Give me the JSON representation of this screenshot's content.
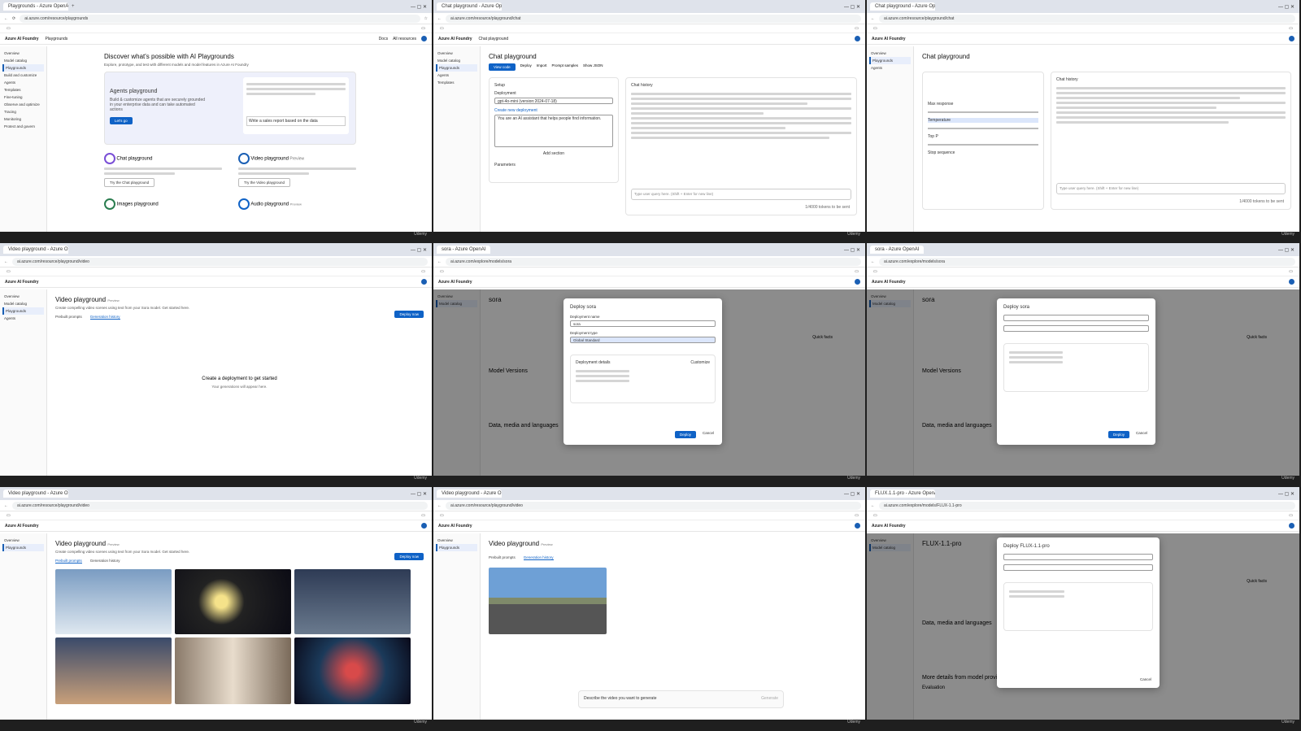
{
  "panels": [
    {
      "tabs": [
        "Playgrounds - Azure OpenAI"
      ],
      "url": "ai.azure.com/resource/playgrounds",
      "app_header": {
        "brand": "Azure AI Foundry",
        "breadcrumb": "Playgrounds",
        "search": "Docs",
        "resources": "All resources"
      },
      "sidebar": [
        "Overview",
        "Model catalog",
        "Playgrounds",
        "Build and customize",
        "Agents",
        "Templates",
        "Fine-tuning",
        "Observe and optimize",
        "Tracing",
        "Monitoring",
        "Protect and govern"
      ],
      "title": "Discover what's possible with AI Playgrounds",
      "subtitle": "Explore, prototype, and test with different models and model features in Azure AI Foundry",
      "agents": {
        "title": "Agents playground",
        "desc": "Build & customize agents that are securely grounded in your enterprise data and can take automated actions",
        "button": "Let's go",
        "prompt": "Write a sales report based on the data"
      },
      "chat": {
        "title": "Chat playground",
        "button": "Try the Chat playground"
      },
      "video": {
        "title": "Video playground",
        "badge": "Preview",
        "button": "Try the Video playground"
      },
      "images": {
        "title": "Images playground"
      },
      "audio": {
        "title": "Audio playground",
        "badge": "Preview"
      }
    },
    {
      "tabs": [
        "Chat playground - Azure OpenAI"
      ],
      "url": "ai.azure.com/resource/playground/chat",
      "breadcrumb": "Chat playground",
      "title": "Chat playground",
      "toolbar": [
        "View code",
        "Deploy",
        "Import",
        "Prompt samples",
        "Show JSON"
      ],
      "setup_label": "Setup",
      "deployment_label": "Deployment",
      "deployment_value": "gpt-4o-mini (version:2024-07-18)",
      "create_button": "Create new deployment",
      "system_message": "You are an AI assistant that helps people find information.",
      "add_section": "Add section",
      "parameters": "Parameters",
      "history_label": "Chat history",
      "input_placeholder": "Type user query here. (Shift + Enter for new line)",
      "tokens": "1/4000 tokens to be sent"
    },
    {
      "tabs": [
        "Chat playground - Azure OpenAI"
      ],
      "url": "ai.azure.com/resource/playground/chat",
      "title": "Chat playground",
      "params": [
        "Max response",
        "Temperature",
        "Top P",
        "Stop sequence"
      ],
      "history_label": "Chat history",
      "input_placeholder": "Type user query here. (Shift + Enter for new line)",
      "tokens": "1/4000 tokens to be sent"
    },
    {
      "tabs": [
        "Video playground - Azure OpenAI"
      ],
      "url": "ai.azure.com/resource/playground/video",
      "title": "Video playground",
      "badge": "Preview",
      "subtitle": "Create compelling video scenes using text from your Sora model. Get started here.",
      "tabs_inner": [
        "Prebuilt prompts",
        "Generation history"
      ],
      "empty_title": "Create a deployment to get started",
      "empty_desc": "Your generations will appear here.",
      "deploy_button": "Deploy now"
    },
    {
      "tabs": [
        "sora - Azure OpenAI"
      ],
      "url": "ai.azure.com/explore/models/sora",
      "model": "sora",
      "dialog_title": "Deploy sora",
      "deployment_name_label": "Deployment name",
      "deployment_name": "sora",
      "deployment_type_label": "Deployment type",
      "deployment_type": "Global Standard",
      "details_label": "Deployment details",
      "customize": "Customize",
      "deploy_btn": "Deploy",
      "cancel_btn": "Cancel",
      "section_versions": "Model Versions",
      "section_data": "Data, media and languages",
      "quick_facts": "Quick facts"
    },
    {
      "tabs": [
        "sora - Azure OpenAI"
      ],
      "url": "ai.azure.com/explore/models/sora",
      "model": "sora",
      "dialog_title": "Deploy sora",
      "deploy_btn": "Deploy",
      "cancel_btn": "Cancel",
      "section_versions": "Model Versions",
      "section_data": "Data, media and languages",
      "quick_facts": "Quick facts"
    },
    {
      "tabs": [
        "Video playground - Azure OpenAI"
      ],
      "url": "ai.azure.com/resource/playground/video",
      "title": "Video playground",
      "badge": "Preview",
      "subtitle": "Create compelling video scenes using text from your Sora model. Get started here.",
      "tabs_inner": [
        "Prebuilt prompts",
        "Generation history"
      ],
      "deploy_button": "Deploy now"
    },
    {
      "tabs": [
        "Video playground - Azure OpenAI"
      ],
      "url": "ai.azure.com/resource/playground/video",
      "title": "Video playground",
      "badge": "Preview",
      "tabs_inner": [
        "Prebuilt prompts",
        "Generation history"
      ],
      "prompt_placeholder": "Describe the video you want to generate",
      "generate": "Generate"
    },
    {
      "tabs": [
        "FLUX.1.1-pro - Azure OpenAI"
      ],
      "url": "ai.azure.com/explore/models/FLUX-1.1-pro",
      "model": "FLUX-1.1-pro",
      "dialog_title": "Deploy FLUX-1.1-pro",
      "section_data": "Data, media and languages",
      "section_more": "More details from model provider",
      "section_eval": "Evaluation",
      "quick_facts": "Quick facts",
      "cancel_btn": "Cancel"
    }
  ],
  "status_text": "Udemy"
}
